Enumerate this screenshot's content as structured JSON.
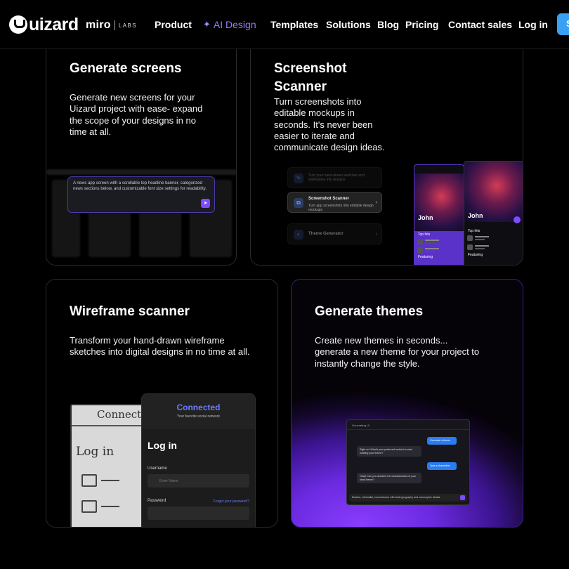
{
  "header": {
    "logo_text": "uizard",
    "partner_name": "miro",
    "partner_labs": "LABS",
    "nav": [
      {
        "label": "Product"
      },
      {
        "label": "AI Design"
      },
      {
        "label": "Templates"
      },
      {
        "label": "Solutions"
      },
      {
        "label": "Blog"
      },
      {
        "label": "Pricing"
      },
      {
        "label": "Contact sales"
      },
      {
        "label": "Log in"
      }
    ],
    "cta_label": "S",
    "ai_icon": "sparkle-icon"
  },
  "cards": {
    "generate_screens": {
      "title": "Generate screens",
      "description": "Generate new screens for your Uizard project with ease- expand the scope of your designs in no time at all.",
      "prompt": "A news app screen with a scrollable top headline banner, categorized news sections below, and customizable font size settings for readability."
    },
    "screenshot_scanner": {
      "title_line1": "Screenshot",
      "title_line2": "Scanner",
      "description": "Turn screenshots into editable mockups in seconds. It's never been easier to iterate and communicate design ideas.",
      "menu_top_sub": "Turn your hand-drawn sketches and wireframes into designs",
      "menu_active_title": "Screenshot Scanner",
      "menu_active_sub": "Turn app screenshots into editable design mockups",
      "menu_bottom_title": "Theme Generator",
      "phone_name": "John",
      "top_hits": "Top hits",
      "featuring": "Featuring"
    },
    "wireframe_scanner": {
      "title": "Wireframe scanner",
      "description": "Transform your hand-drawn wireframe sketches into digital designs in no time at all.",
      "sketch_title": "Connecte",
      "sketch_login": "Log in",
      "app_brand": "Connected",
      "app_tagline": "Your favorite social network",
      "login_title": "Log in",
      "username_label": "Username",
      "username_placeholder": "Enter Name",
      "password_label": "Password",
      "forgot_link": "Forgot your password?"
    },
    "generate_themes": {
      "title": "Generate themes",
      "description": "Create new themes in seconds... generate a new theme for your project to instantly change the style.",
      "chat_header": "Generating UI",
      "msg1": "Generate a theme",
      "msg2": "Right on! What's your preferred method to start building your theme?",
      "msg3": "Type a description",
      "msg4": "Okay! Can you describe the characteristics of your ideal theme?",
      "input": "Modern, minimalist, monochrome with bold typography and neumorphic details"
    }
  },
  "colors": {
    "accent_purple": "#7b4dff",
    "cta_blue": "#3aa0f3",
    "ai_nav": "#9a78ff"
  }
}
